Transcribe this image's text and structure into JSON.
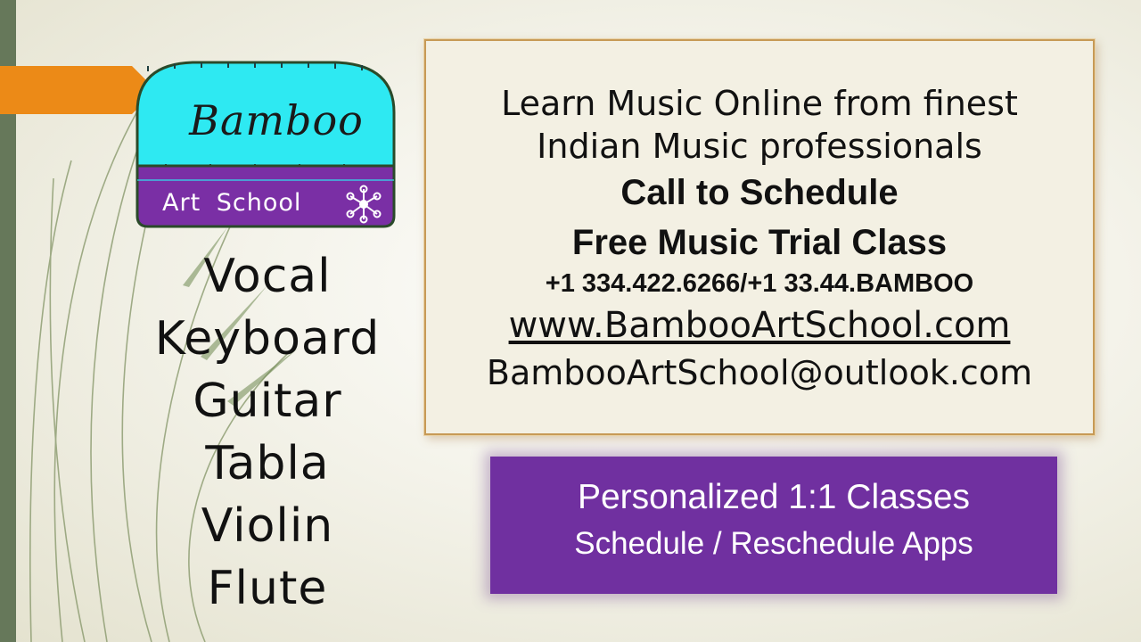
{
  "colors": {
    "accent_orange": "#ec8a17",
    "sidebar_green": "#66785a",
    "logo_cyan": "#2ee9f2",
    "logo_purple": "#7a2fa5",
    "promo_purple": "#7030a0",
    "card_border": "#c79a56"
  },
  "logo": {
    "title": "Bamboo",
    "subtitle": "Art School",
    "icon": "network-nodes-icon"
  },
  "instruments": [
    "Vocal",
    "Keyboard",
    "Guitar",
    "Tabla",
    "Violin",
    "Flute"
  ],
  "info_card": {
    "line1": "Learn Music Online from finest",
    "line2": "Indian Music professionals",
    "cta1": "Call to Schedule",
    "cta2": "Free Music Trial Class",
    "phone": "+1 334.422.6266/+1 33.44.BAMBOO",
    "website": "www.BambooArtSchool.com",
    "email": "BambooArtSchool@outlook.com"
  },
  "promo": {
    "line1": "Personalized 1:1 Classes",
    "line2": "Schedule / Reschedule Apps"
  }
}
